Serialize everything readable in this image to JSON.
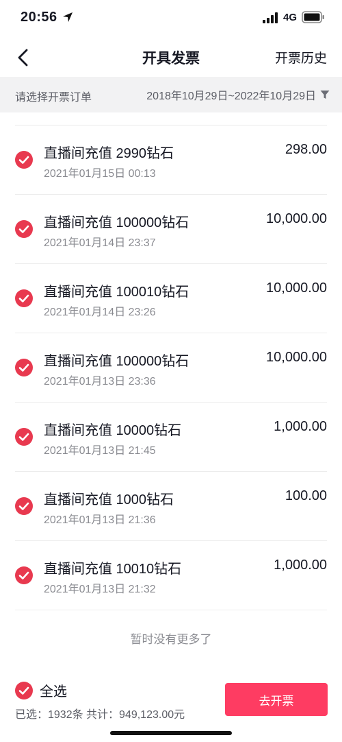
{
  "status_bar": {
    "time": "20:56",
    "network": "4G",
    "icons": [
      "location-arrow-icon",
      "signal-icon",
      "battery-icon"
    ]
  },
  "nav": {
    "title": "开具发票",
    "history": "开票历史",
    "back_icon": "back-chevron-icon"
  },
  "filter": {
    "label": "请选择开票订单",
    "date_range": "2018年10月29日~2022年10月29日",
    "icon": "filter-icon"
  },
  "orders": [
    {
      "name": "直播间充值 2990钻石",
      "date": "2021年01月15日 00:13",
      "amount": "298.00",
      "selected": true
    },
    {
      "name": "直播间充值 100000钻石",
      "date": "2021年01月14日 23:37",
      "amount": "10,000.00",
      "selected": true
    },
    {
      "name": "直播间充值 100010钻石",
      "date": "2021年01月14日 23:26",
      "amount": "10,000.00",
      "selected": true
    },
    {
      "name": "直播间充值 100000钻石",
      "date": "2021年01月13日 23:36",
      "amount": "10,000.00",
      "selected": true
    },
    {
      "name": "直播间充值 10000钻石",
      "date": "2021年01月13日 21:45",
      "amount": "1,000.00",
      "selected": true
    },
    {
      "name": "直播间充值 1000钻石",
      "date": "2021年01月13日 21:36",
      "amount": "100.00",
      "selected": true
    },
    {
      "name": "直播间充值 10010钻石",
      "date": "2021年01月13日 21:32",
      "amount": "1,000.00",
      "selected": true
    }
  ],
  "no_more": "暂时没有更多了",
  "bottom": {
    "select_all": "全选",
    "summary": "已选：1932条 共计：949,123.00元",
    "issue_button": "去开票"
  },
  "colors": {
    "accent": "#fe2c55",
    "check": "#e8394f",
    "filter_bg": "#f2f2f3"
  }
}
